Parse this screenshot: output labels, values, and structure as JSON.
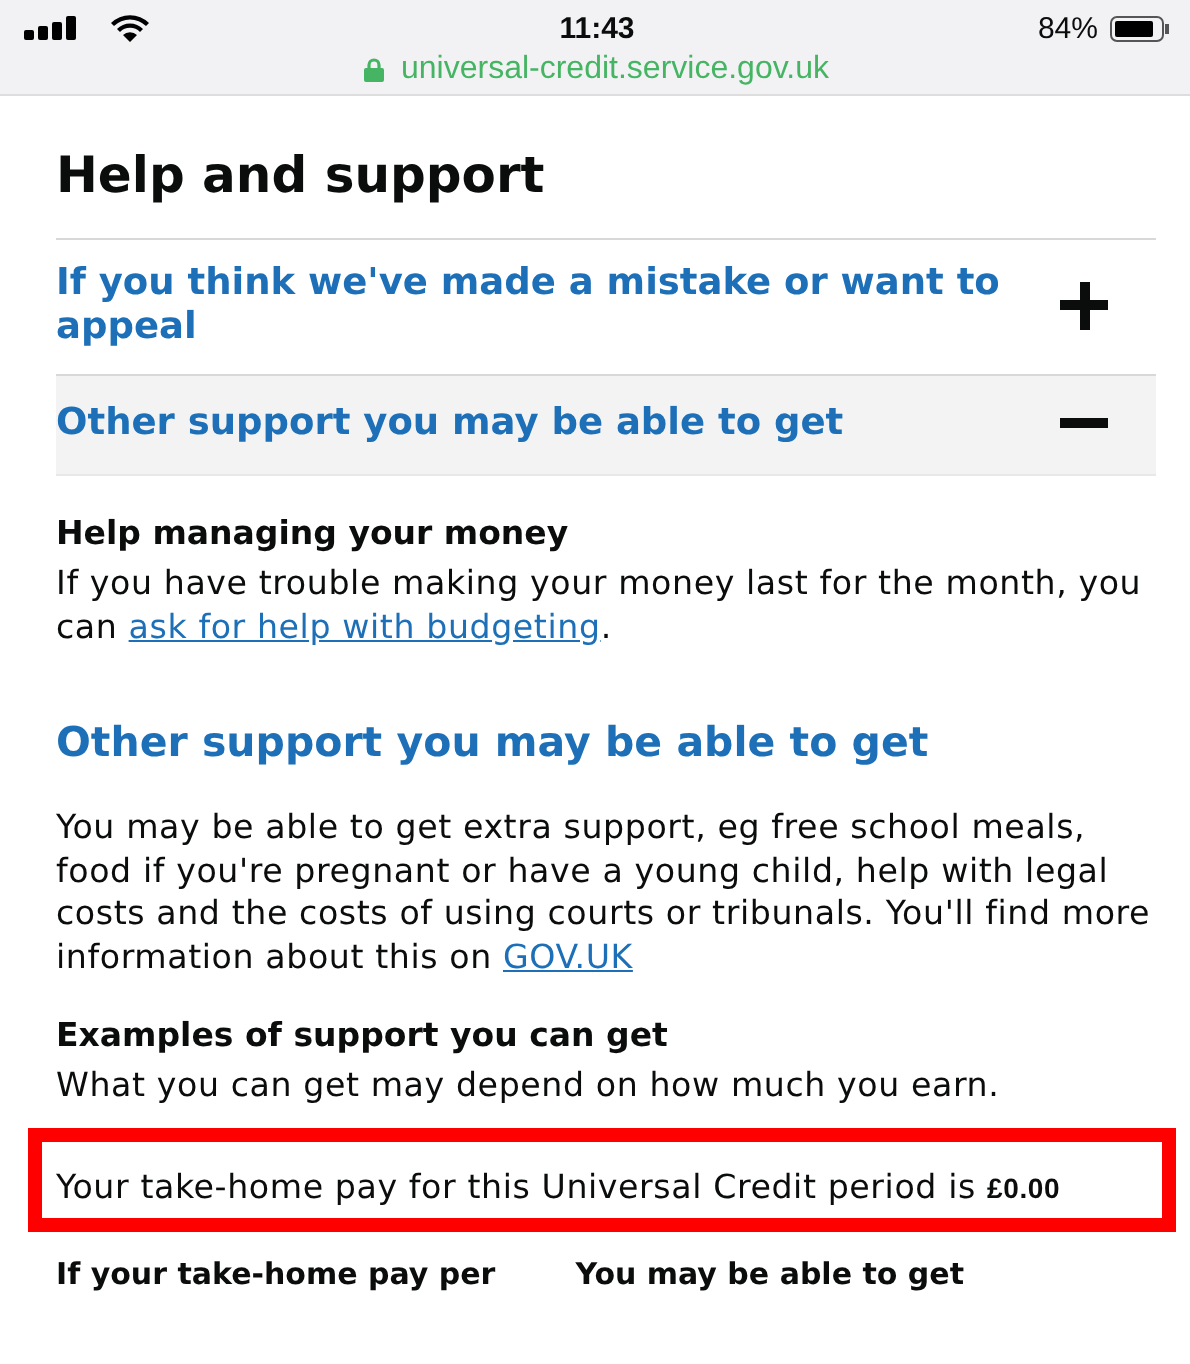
{
  "status_bar": {
    "time": "11:43",
    "battery": "84%",
    "url": "universal-credit.service.gov.uk"
  },
  "page": {
    "title": "Help and support",
    "accordion": [
      {
        "title": "If you think we've made a mistake or want to appeal",
        "expanded": false
      },
      {
        "title": "Other support you may be able to get",
        "expanded": true
      }
    ],
    "content": [
      {
        "kind": "subheading",
        "text": "Help managing your money"
      },
      {
        "kind": "paragraph",
        "parts": [
          {
            "kind": "text",
            "text": "If you have trouble making your money last for the month, you can "
          },
          {
            "kind": "link",
            "text": "ask for help with budgeting"
          },
          {
            "kind": "text",
            "text": "."
          }
        ]
      },
      {
        "kind": "heading",
        "text": "Other support you may be able to get"
      },
      {
        "kind": "paragraph",
        "parts": [
          {
            "kind": "text",
            "text": "You may be able to get extra support, eg free school meals, food if you're pregnant or have a young child, help with legal costs and the costs of using courts or tribunals. You'll find more information about this on "
          },
          {
            "kind": "link",
            "text": "GOV.UK"
          }
        ]
      },
      {
        "kind": "subheading",
        "text": "Examples of support you can get"
      },
      {
        "kind": "paragraph",
        "parts": [
          {
            "kind": "text",
            "text": "What you can get may depend on how much you earn."
          }
        ]
      },
      {
        "kind": "highlight",
        "text": "Your take-home pay for this Universal Credit period is **£0.00**"
      }
    ],
    "table": {
      "columns": [
        "If your take-home pay per",
        "You may be able to get"
      ]
    }
  }
}
